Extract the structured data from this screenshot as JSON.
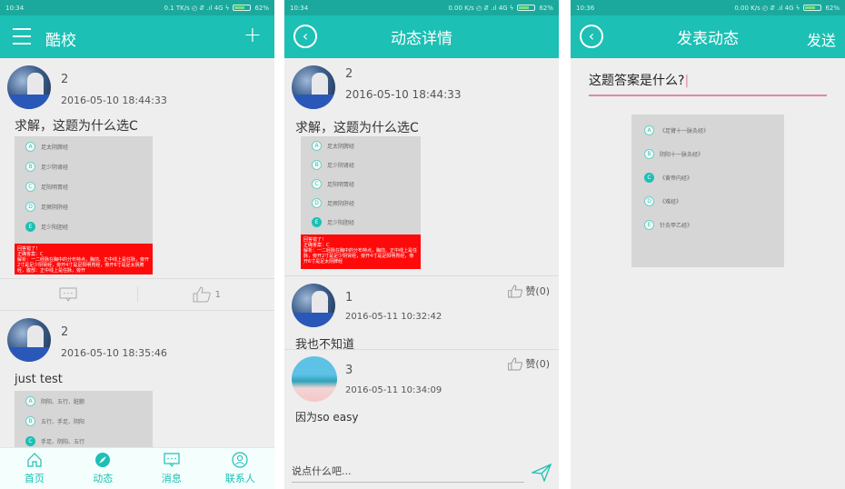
{
  "screens": [
    {
      "status": {
        "time": "10:34",
        "right": "0.1 TK/s ◴ ⇵ .ıl 4G ϟ",
        "battery": "62%"
      },
      "appbar": {
        "title": "酷校"
      },
      "posts": [
        {
          "user": "2",
          "time": "2016-05-10 18:44:33",
          "text": "求解，这题为什么选C",
          "options": [
            {
              "letter": "A",
              "label": "足太阴脾经"
            },
            {
              "letter": "B",
              "label": "足少阴肾经"
            },
            {
              "letter": "C",
              "label": "足阳明胃经"
            },
            {
              "letter": "D",
              "label": "足厥阴肝经"
            },
            {
              "letter": "E",
              "label": "足少阳胆经"
            }
          ],
          "answer_text": "回答错了！\n正确答案：C\n解析：一二经脉在胸中的分布特点，胸前、正中线上是任脉，旁开2寸是足少阴肾经，旁开4寸是足阳明胃经，旁开6寸是足太阴脾经，腹部：正中线上是任脉，旁开",
          "like_count": "1"
        },
        {
          "user": "2",
          "time": "2016-05-10 18:35:46",
          "text": "just test",
          "options": [
            {
              "letter": "A",
              "label": "阴阳、五行、脏腑"
            },
            {
              "letter": "B",
              "label": "五行、手足、阴阳"
            },
            {
              "letter": "C",
              "label": "手足、阴阳、五行"
            }
          ]
        }
      ],
      "tabbar": {
        "items": [
          {
            "label": "首页",
            "icon": "home-icon"
          },
          {
            "label": "动态",
            "icon": "compass-icon"
          },
          {
            "label": "消息",
            "icon": "message-icon"
          },
          {
            "label": "联系人",
            "icon": "contact-icon"
          }
        ]
      }
    },
    {
      "status": {
        "time": "10:34",
        "right": "0.00 K/s ◴ ⇵ .ıl 4G ϟ",
        "battery": "62%"
      },
      "appbar": {
        "title": "动态详情"
      },
      "post": {
        "user": "2",
        "time": "2016-05-10 18:44:33",
        "text": "求解，这题为什么选C",
        "options": [
          {
            "letter": "A",
            "label": "足太阴脾经"
          },
          {
            "letter": "B",
            "label": "足少阴肾经"
          },
          {
            "letter": "C",
            "label": "足阳明胃经"
          },
          {
            "letter": "D",
            "label": "足厥阴肝经"
          },
          {
            "letter": "E",
            "label": "足少阳胆经"
          }
        ],
        "answer_text": "回答错了！\n正确答案：C\n解析：一二经脉在胸中的分布特点，胸前、正中线上是任脉，旁开2寸是足少阴肾经，旁开4寸是足阳明胃经，旁开6寸是足太阴脾经"
      },
      "comments": [
        {
          "user": "1",
          "time": "2016-05-11 10:32:42",
          "text": "我也不知道",
          "like_label": "赞(0)"
        },
        {
          "user": "3",
          "time": "2016-05-11 10:34:09",
          "text": "因为so  easy",
          "like_label": "赞(0)"
        }
      ],
      "input": {
        "placeholder": "说点什么吧..."
      }
    },
    {
      "status": {
        "time": "10:36",
        "right": "0.00 K/s ◴ ⇵ .ıl 4G ϟ",
        "battery": "62%"
      },
      "appbar": {
        "title": "发表动态",
        "action": "发送"
      },
      "editor": {
        "value": "这题答案是什么?"
      },
      "options": [
        {
          "letter": "A",
          "label": "《足臂十一脉灸经》"
        },
        {
          "letter": "B",
          "label": "阴阳十一脉灸经》"
        },
        {
          "letter": "C",
          "label": "《黄帝内经》"
        },
        {
          "letter": "D",
          "label": "《难经》"
        },
        {
          "letter": "E",
          "label": "针灸甲乙经》"
        }
      ],
      "selected_option": "C"
    }
  ],
  "colors": {
    "primary": "#1cc0b4",
    "status_bar": "#1ba99d",
    "background": "#eeeeee",
    "answer_red": "#ff0a0a",
    "editor_underline": "#e08aa0"
  }
}
